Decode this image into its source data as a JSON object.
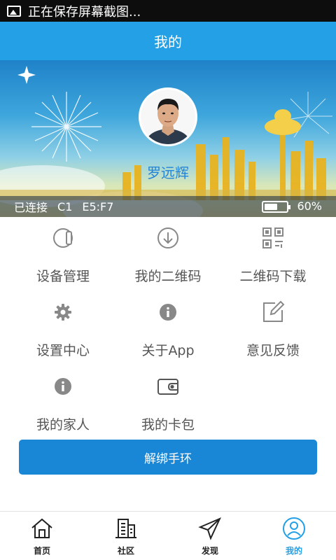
{
  "status_bar": {
    "notification_text": "正在保存屏幕截图..."
  },
  "app_bar": {
    "title": "我的"
  },
  "profile": {
    "name": "罗远辉",
    "connection_status": "已连接",
    "mode": "C1",
    "device_id": "E5:F7",
    "battery_percent_label": "60%",
    "battery_level": 0.6
  },
  "menu": [
    {
      "label": "设备管理",
      "icon": "watch-icon"
    },
    {
      "label": "我的二维码",
      "icon": "download-circle-icon"
    },
    {
      "label": "二维码下载",
      "icon": "qr-code-icon"
    },
    {
      "label": "设置中心",
      "icon": "gear-icon"
    },
    {
      "label": "关于App",
      "icon": "info-icon"
    },
    {
      "label": "意见反馈",
      "icon": "edit-icon"
    },
    {
      "label": "我的家人",
      "icon": "info-icon"
    },
    {
      "label": "我的卡包",
      "icon": "wallet-icon"
    }
  ],
  "unbind_button": {
    "label": "解绑手环"
  },
  "tab_bar": {
    "tabs": [
      {
        "label": "首页",
        "icon": "home-icon"
      },
      {
        "label": "社区",
        "icon": "buildings-icon"
      },
      {
        "label": "发现",
        "icon": "paper-plane-icon"
      },
      {
        "label": "我的",
        "icon": "user-circle-icon"
      }
    ],
    "active_index": 3
  },
  "colors": {
    "accent": "#23a0e6",
    "button": "#1a86d6",
    "icon_gray": "#888888"
  }
}
